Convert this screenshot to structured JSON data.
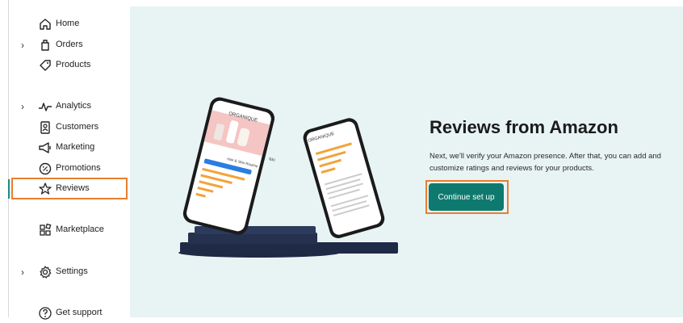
{
  "sidebar": {
    "items": [
      {
        "label": "Home",
        "icon": "home-icon",
        "has_chevron": false
      },
      {
        "label": "Orders",
        "icon": "orders-icon",
        "has_chevron": true
      },
      {
        "label": "Products",
        "icon": "tag-icon",
        "has_chevron": false
      },
      {
        "label": "Analytics",
        "icon": "pulse-icon",
        "has_chevron": true
      },
      {
        "label": "Customers",
        "icon": "customers-icon",
        "has_chevron": false
      },
      {
        "label": "Marketing",
        "icon": "megaphone-icon",
        "has_chevron": false
      },
      {
        "label": "Promotions",
        "icon": "percent-badge-icon",
        "has_chevron": false
      },
      {
        "label": "Reviews",
        "icon": "star-icon",
        "has_chevron": false,
        "selected": true
      },
      {
        "label": "Marketplace",
        "icon": "apps-grid-icon",
        "has_chevron": false
      },
      {
        "label": "Settings",
        "icon": "gear-icon",
        "has_chevron": true
      },
      {
        "label": "Get support",
        "icon": "help-icon",
        "has_chevron": false
      }
    ],
    "chevron_glyph": "›"
  },
  "hero": {
    "title": "Reviews from Amazon",
    "description": "Next, we'll verify your Amazon presence. After that, you can add and customize ratings and reviews for your products.",
    "cta_label": "Continue set up"
  },
  "phone_screen": {
    "brand": "ORGANIQUE",
    "product_title": "Hair & Skin Routine",
    "price": "$30"
  },
  "colors": {
    "accent": "#0e7a6f",
    "highlight": "#e87f2e",
    "hero_bg": "#e8f4f4"
  }
}
